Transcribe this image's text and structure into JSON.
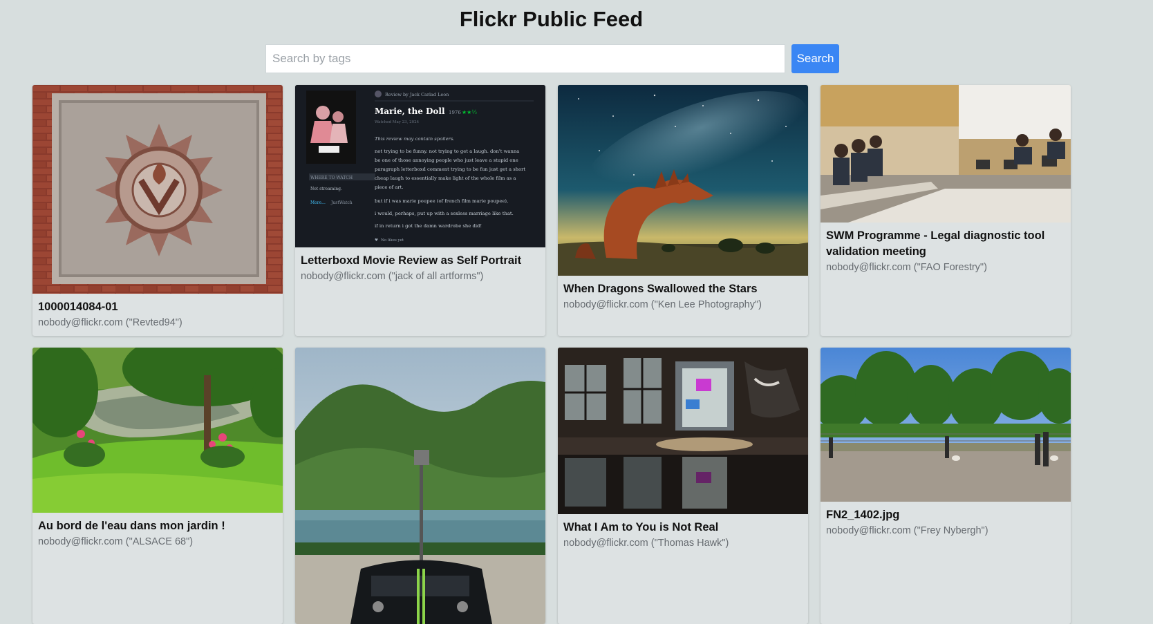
{
  "header": {
    "title": "Flickr Public Feed"
  },
  "search": {
    "placeholder": "Search by tags",
    "value": "",
    "button_label": "Search"
  },
  "photos": [
    {
      "title": "1000014084-01",
      "author": "nobody@flickr.com (\"Revted94\")",
      "image": "brick-plaque"
    },
    {
      "title": "Letterboxd Movie Review as Self Portrait",
      "author": "nobody@flickr.com (\"jack of all artforms\")",
      "image": "letterboxd-screenshot"
    },
    {
      "title": "When Dragons Swallowed the Stars",
      "author": "nobody@flickr.com (\"Ken Lee Photography\")",
      "image": "dragon-night-sky"
    },
    {
      "title": "SWM Programme - Legal diagnostic tool validation meeting",
      "author": "nobody@flickr.com (\"FAO Forestry\")",
      "image": "meeting-room"
    },
    {
      "title": "Au bord de l'eau dans mon jardin !",
      "author": "nobody@flickr.com (\"ALSACE 68\")",
      "image": "garden-pond"
    },
    {
      "title": "",
      "author": "",
      "image": "car-lake-mountain"
    },
    {
      "title": "What I Am to You is Not Real",
      "author": "nobody@flickr.com (\"Thomas Hawk\")",
      "image": "graffiti-reflection"
    },
    {
      "title": "FN2_1402.jpg",
      "author": "nobody@flickr.com (\"Frey Nybergh\")",
      "image": "park-dogs"
    }
  ],
  "letterboxd": {
    "review_by": "Review by Jack Carlad Leon",
    "film": "Marie, the Doll",
    "year": "1976",
    "watched": "Watched May 23, 2024",
    "spoiler": "This review may contain spoilers.",
    "lines": [
      "not trying to be funny. not trying to get a laugh. don't wanna",
      "be one of those annoying people who just leave a stupid one",
      "paragraph letterboxd comment trying to be fun just get a short",
      "cheap laugh to essentially make light of the whole film as a",
      "piece of art.",
      "but if i was marie poupee (of french film marie poupee),",
      "i would, perhaps, put up with a sexless marriage like that.",
      "if in return i got the damn wardrobe she did!"
    ],
    "where_to_watch": "WHERE TO WATCH",
    "not_streaming": "Not streaming.",
    "more": "More...",
    "justwatch": "JustWatch",
    "no_likes": "No likes yet"
  },
  "colors": {
    "background": "#d7dede",
    "card": "#dde2e3",
    "accent": "#3a86f4"
  }
}
